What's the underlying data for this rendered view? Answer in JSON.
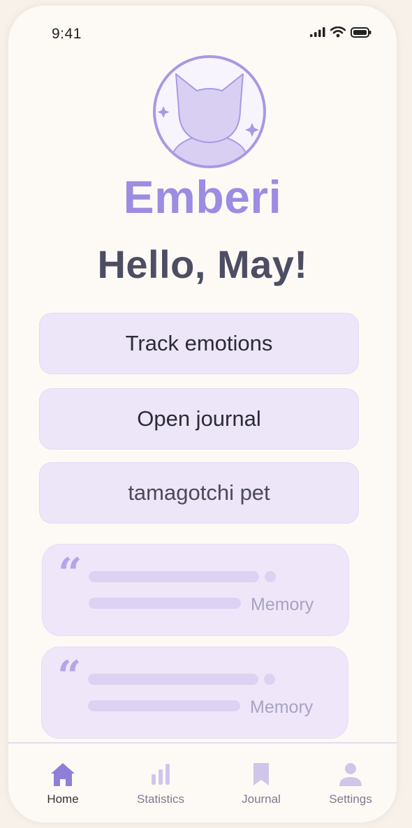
{
  "status_bar": {
    "time": "9:41",
    "icons": [
      "signal-icon",
      "wifi-icon",
      "battery-icon"
    ]
  },
  "app": {
    "name": "Emberi",
    "greeting": "Hello, May!"
  },
  "actions": [
    {
      "label": "Track emotions"
    },
    {
      "label": "Open journal"
    },
    {
      "label": "tamagotchi pet"
    }
  ],
  "memories": [
    {
      "label": "Memory",
      "icon": "quote-icon"
    },
    {
      "label": "Memory",
      "icon": "quote-icon"
    }
  ],
  "tab_bar": {
    "active": "Home",
    "tabs": [
      {
        "label": "Home",
        "icon": "home-icon"
      },
      {
        "label": "Statistics",
        "icon": "bar-chart-icon"
      },
      {
        "label": "Journal",
        "icon": "bookmark-icon"
      },
      {
        "label": "Settings",
        "icon": "user-icon"
      }
    ]
  },
  "colors": {
    "background": "#fdfaf6",
    "accent": "#9c8ce2",
    "card": "#ede5f8",
    "text": "#4d4d63"
  }
}
